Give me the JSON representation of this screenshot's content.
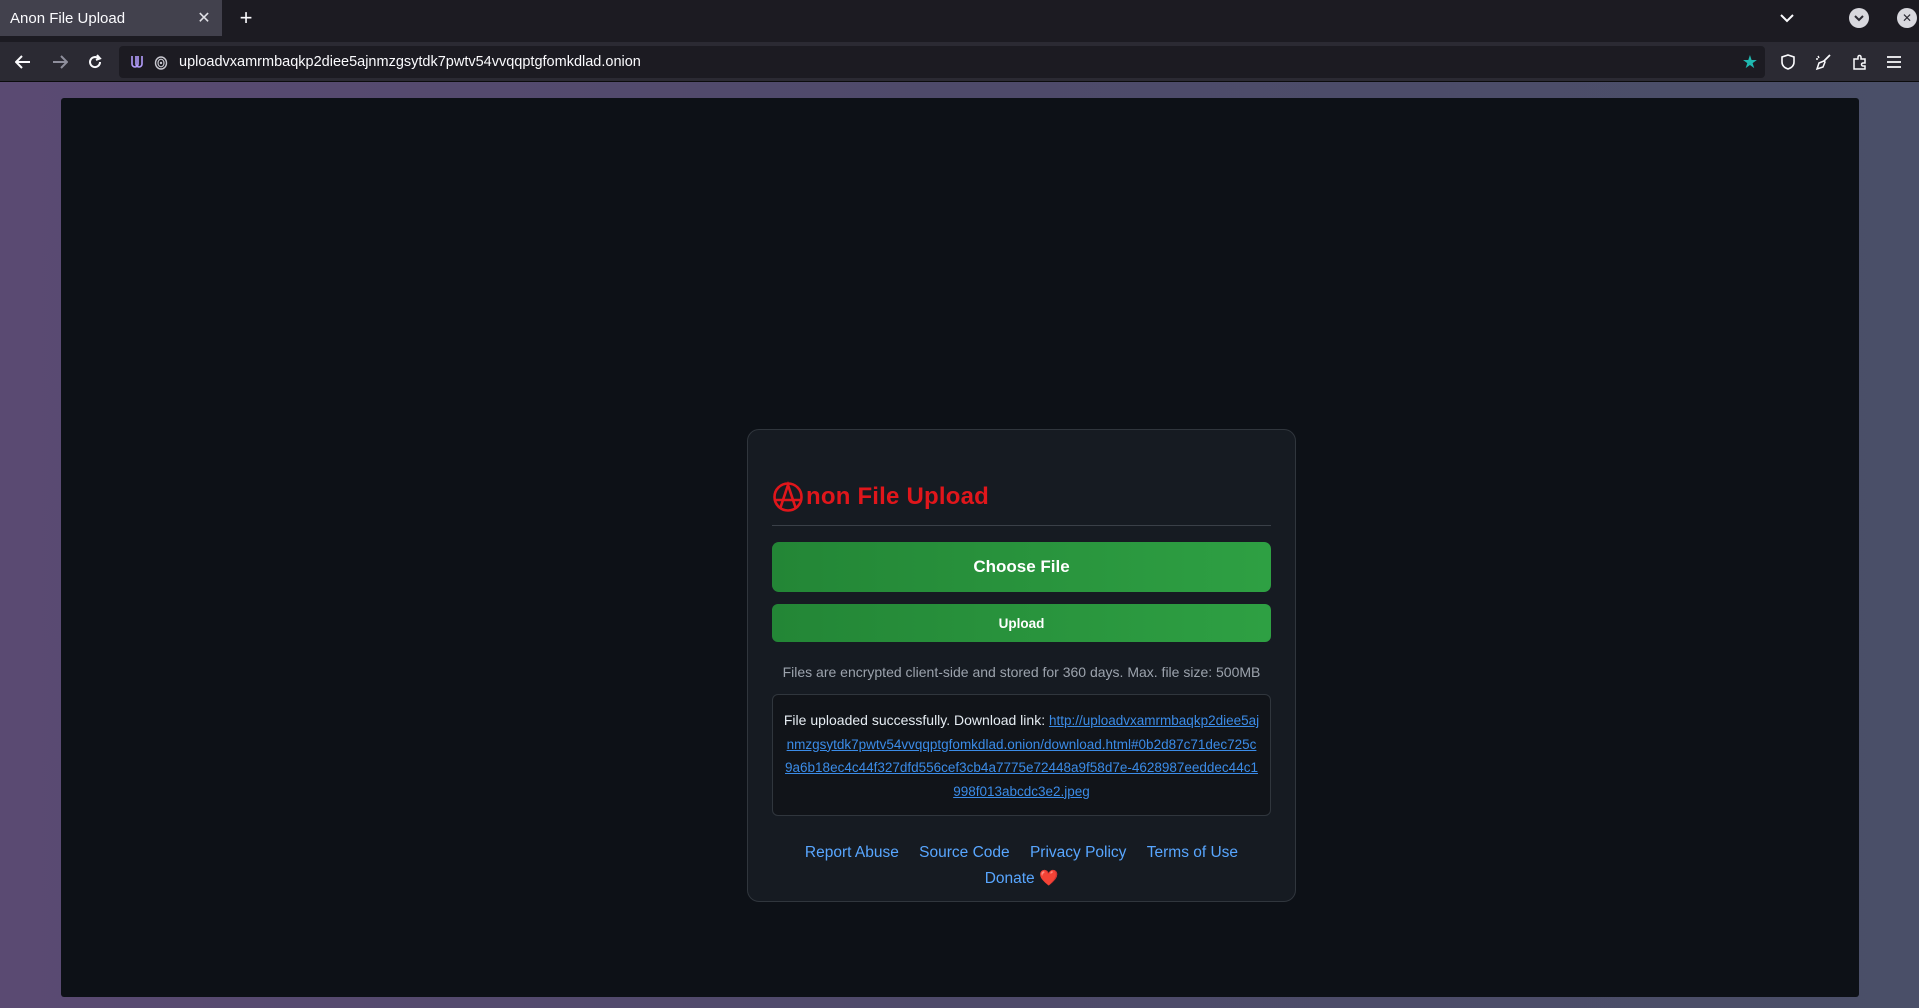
{
  "browser": {
    "tab_title": "Anon File Upload",
    "tab_close_icon": "close-icon",
    "new_tab_label": "+",
    "url": "uploadvxamrmbaqkp2diee5ajnmzgsytdk7pwtv54vvqqptgfomkdlad.onion"
  },
  "page": {
    "title_rest": "non File Upload",
    "logo_icon": "anarchy-a-icon",
    "choose_file_label": "Choose File",
    "upload_label": "Upload",
    "info": "Files are encrypted client-side and stored for 360 days. Max. file size: 500MB",
    "result_prefix": "File uploaded successfully. Download link: ",
    "result_link": "http://uploadvxamrmbaqkp2diee5ajnmzgsytdk7pwtv54vvqqptgfomkdlad.onion/download.html#0b2d87c71dec725c9a6b18ec4c44f327dfd556cef3cb4a7775e72448a9f58d7e-4628987eeddec44c1998f013abcdc3e2.jpeg",
    "footer": {
      "report_abuse": "Report Abuse",
      "source_code": "Source Code",
      "privacy_policy": "Privacy Policy",
      "terms_of_use": "Terms of Use",
      "donate": "Donate",
      "donate_icon": "❤️"
    }
  },
  "colors": {
    "title_red": "#e0161b",
    "button_green": "#2ea043",
    "link_blue": "#58a6ff",
    "bookmark_star": "#1fb8b0"
  }
}
